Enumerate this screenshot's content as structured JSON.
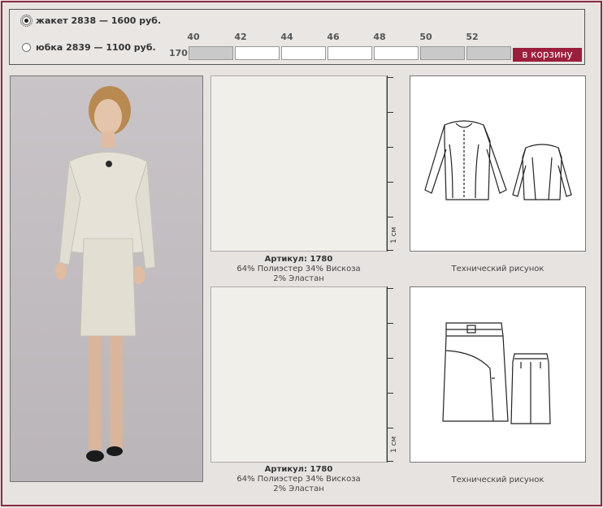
{
  "options": [
    {
      "label": "жакет  2838 — 1600 руб.",
      "selected": true
    },
    {
      "label": "юбка  2839 — 1100 руб.",
      "selected": false
    }
  ],
  "sizes": [
    "40",
    "42",
    "44",
    "46",
    "48",
    "50",
    "52"
  ],
  "height": "170",
  "availability": [
    false,
    true,
    true,
    true,
    true,
    false,
    false
  ],
  "cart_button": "в корзину",
  "fabric": [
    {
      "article": "Артикул: 1780",
      "line1": "64% Полиэстер 34% Вискоза",
      "line2": "2% Эластан",
      "ruler": "1 см"
    },
    {
      "article": "Артикул: 1780",
      "line1": "64% Полиэстер 34% Вискоза",
      "line2": "2% Эластан",
      "ruler": "1 см"
    }
  ],
  "tech_captions": [
    "Технический рисунок",
    "Технический рисунок"
  ],
  "colors": {
    "accent": "#9b1f3d",
    "frame": "#8a2a3f",
    "unavailable": "#c9c9c9"
  }
}
